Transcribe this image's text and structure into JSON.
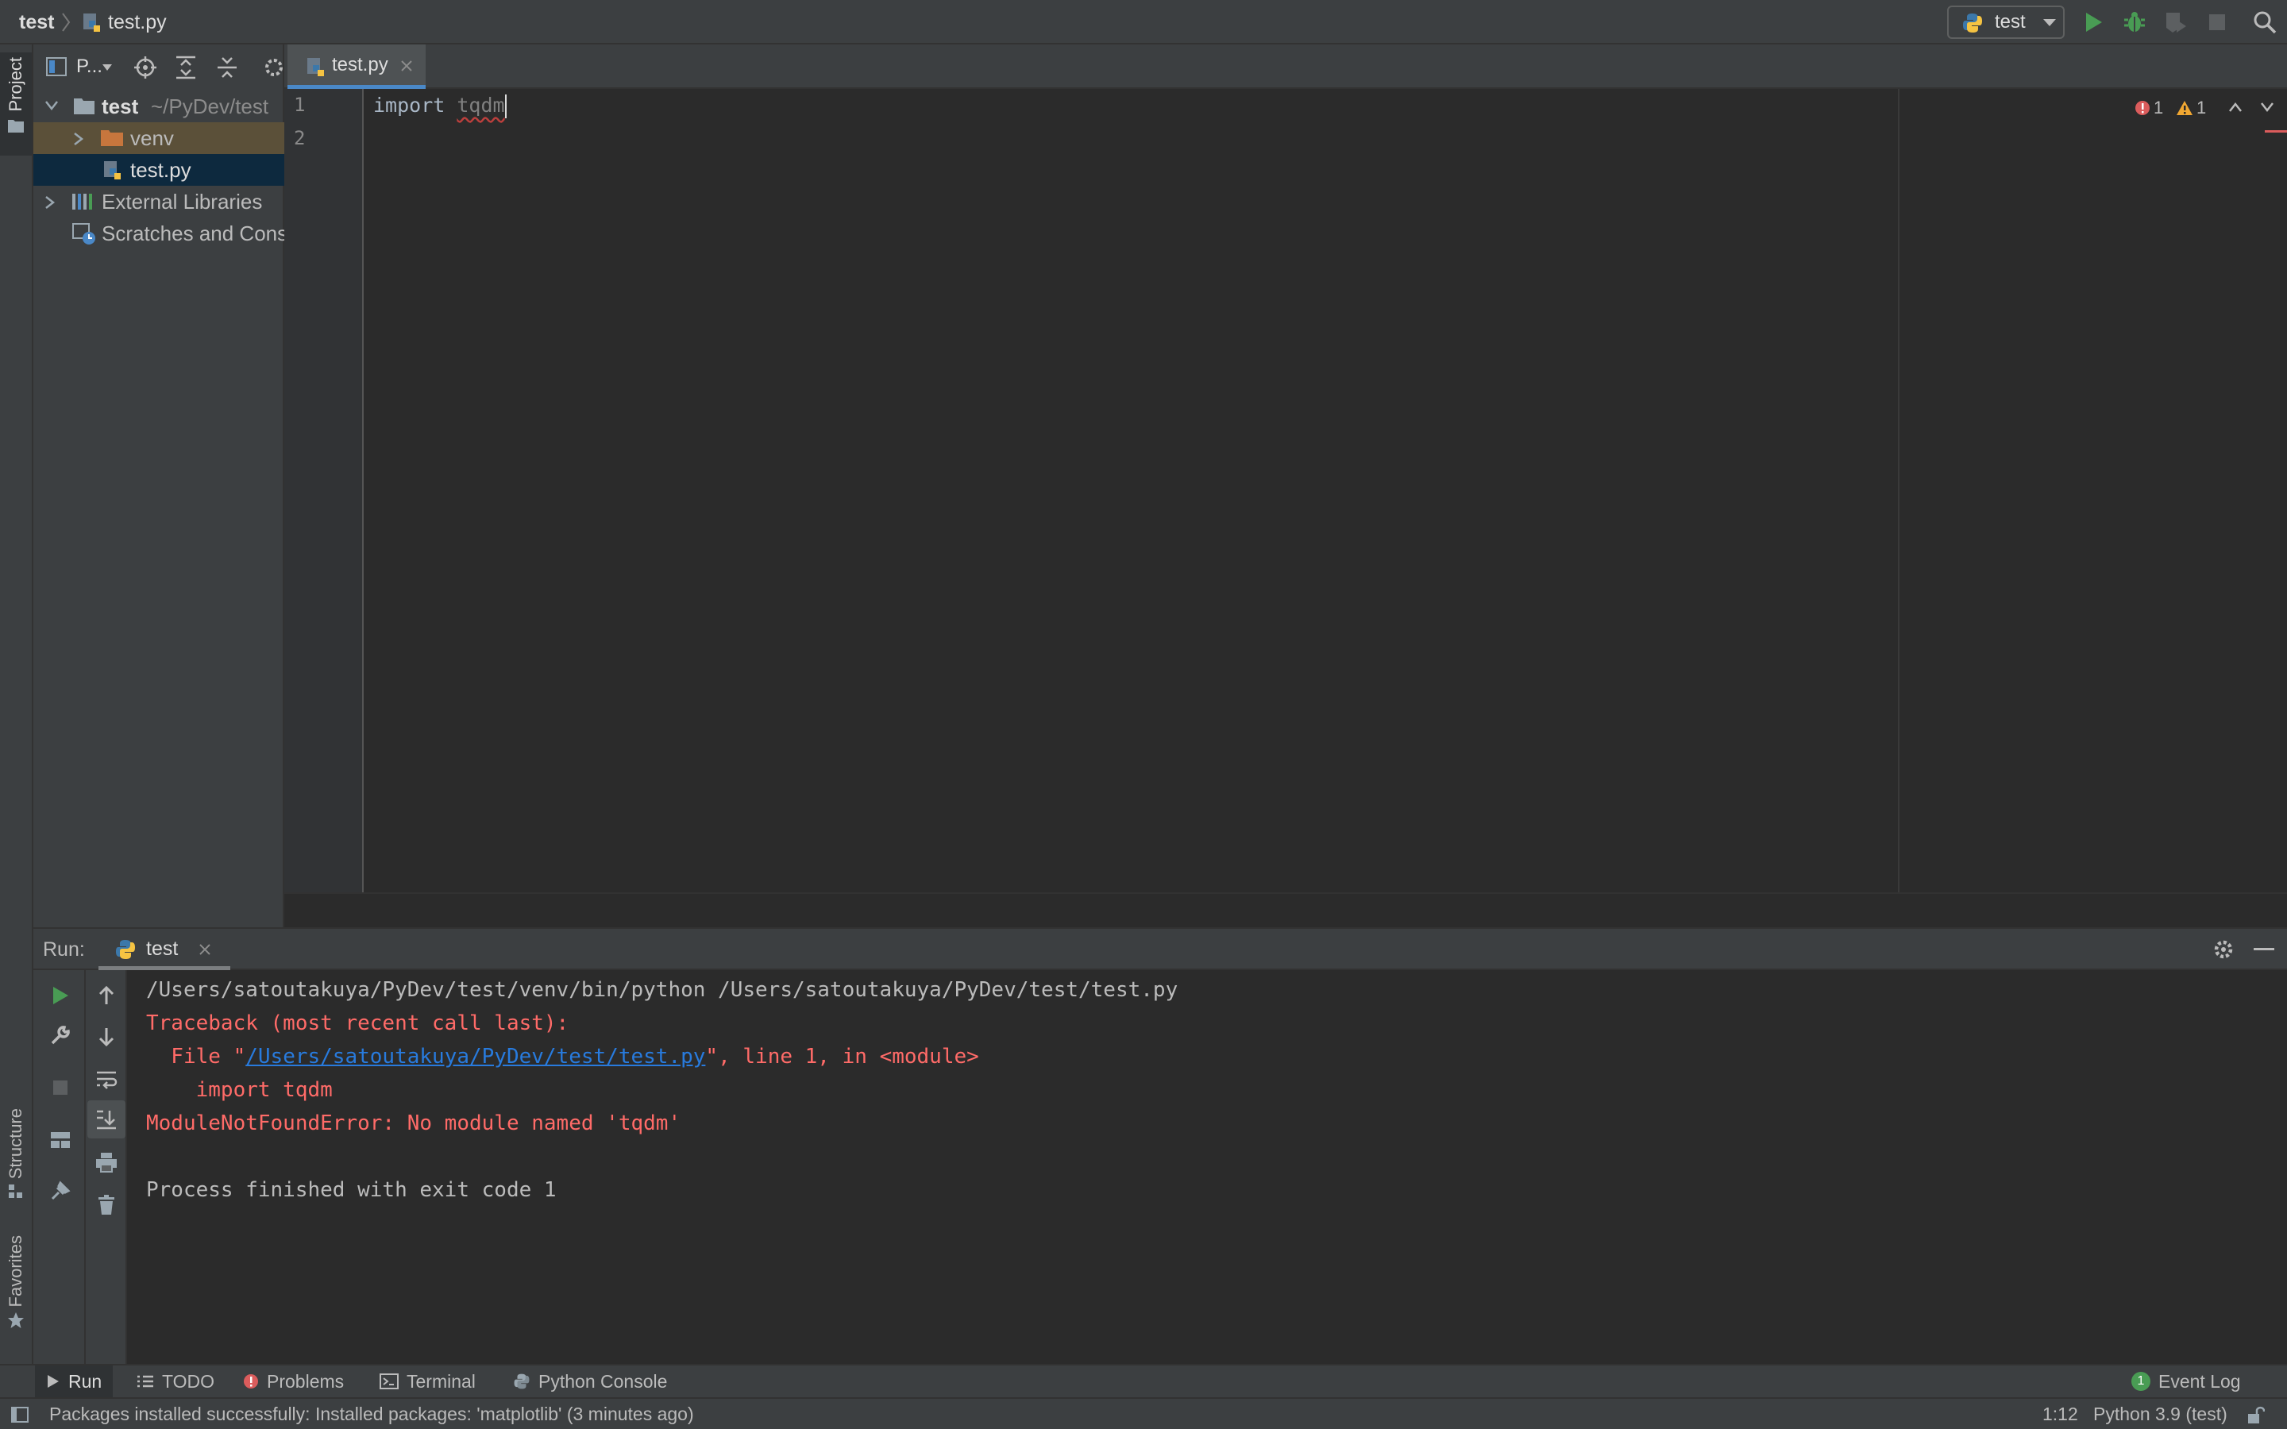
{
  "navbar": {
    "project": "test",
    "file": "test.py",
    "run_config": "test"
  },
  "left_stripe": {
    "project_tab": "Project",
    "structure_tab": "Structure",
    "favorites_tab": "Favorites"
  },
  "project_panel": {
    "selector_label": "P...",
    "tree": {
      "root": {
        "name": "test",
        "path": "~/PyDev/test"
      },
      "venv": "venv",
      "file": "test.py",
      "external_libraries": "External Libraries",
      "scratches": "Scratches and Consoles"
    }
  },
  "editor": {
    "tab_label": "test.py",
    "line_numbers": [
      "1",
      "2"
    ],
    "code": {
      "keyword": "import",
      "module": "tqdm"
    },
    "inspection": {
      "errors": "1",
      "warnings": "1"
    }
  },
  "run_panel": {
    "title": "Run:",
    "tab_label": "test",
    "console": {
      "command": "/Users/satoutakuya/PyDev/test/venv/bin/python /Users/satoutakuya/PyDev/test/test.py",
      "traceback_header": "Traceback (most recent call last):",
      "file_prefix": "  File \"",
      "file_link": "/Users/satoutakuya/PyDev/test/test.py",
      "file_suffix": "\", line 1, in <module>",
      "code_line": "    import tqdm",
      "error": "ModuleNotFoundError: No module named 'tqdm'",
      "exit": "Process finished with exit code 1"
    }
  },
  "tool_windows": {
    "run": "Run",
    "todo": "TODO",
    "problems": "Problems",
    "terminal": "Terminal",
    "python_console": "Python Console",
    "event_log": "Event Log",
    "event_log_count": "1"
  },
  "status_bar": {
    "message": "Packages installed successfully: Installed packages: 'matplotlib' (3 minutes ago)",
    "position": "1:12",
    "interpreter": "Python 3.9 (test)"
  },
  "colors": {
    "accent": "#4a88c7",
    "error": "#ff6b68",
    "run_green": "#499c54",
    "folder_orange": "#c7763d"
  }
}
